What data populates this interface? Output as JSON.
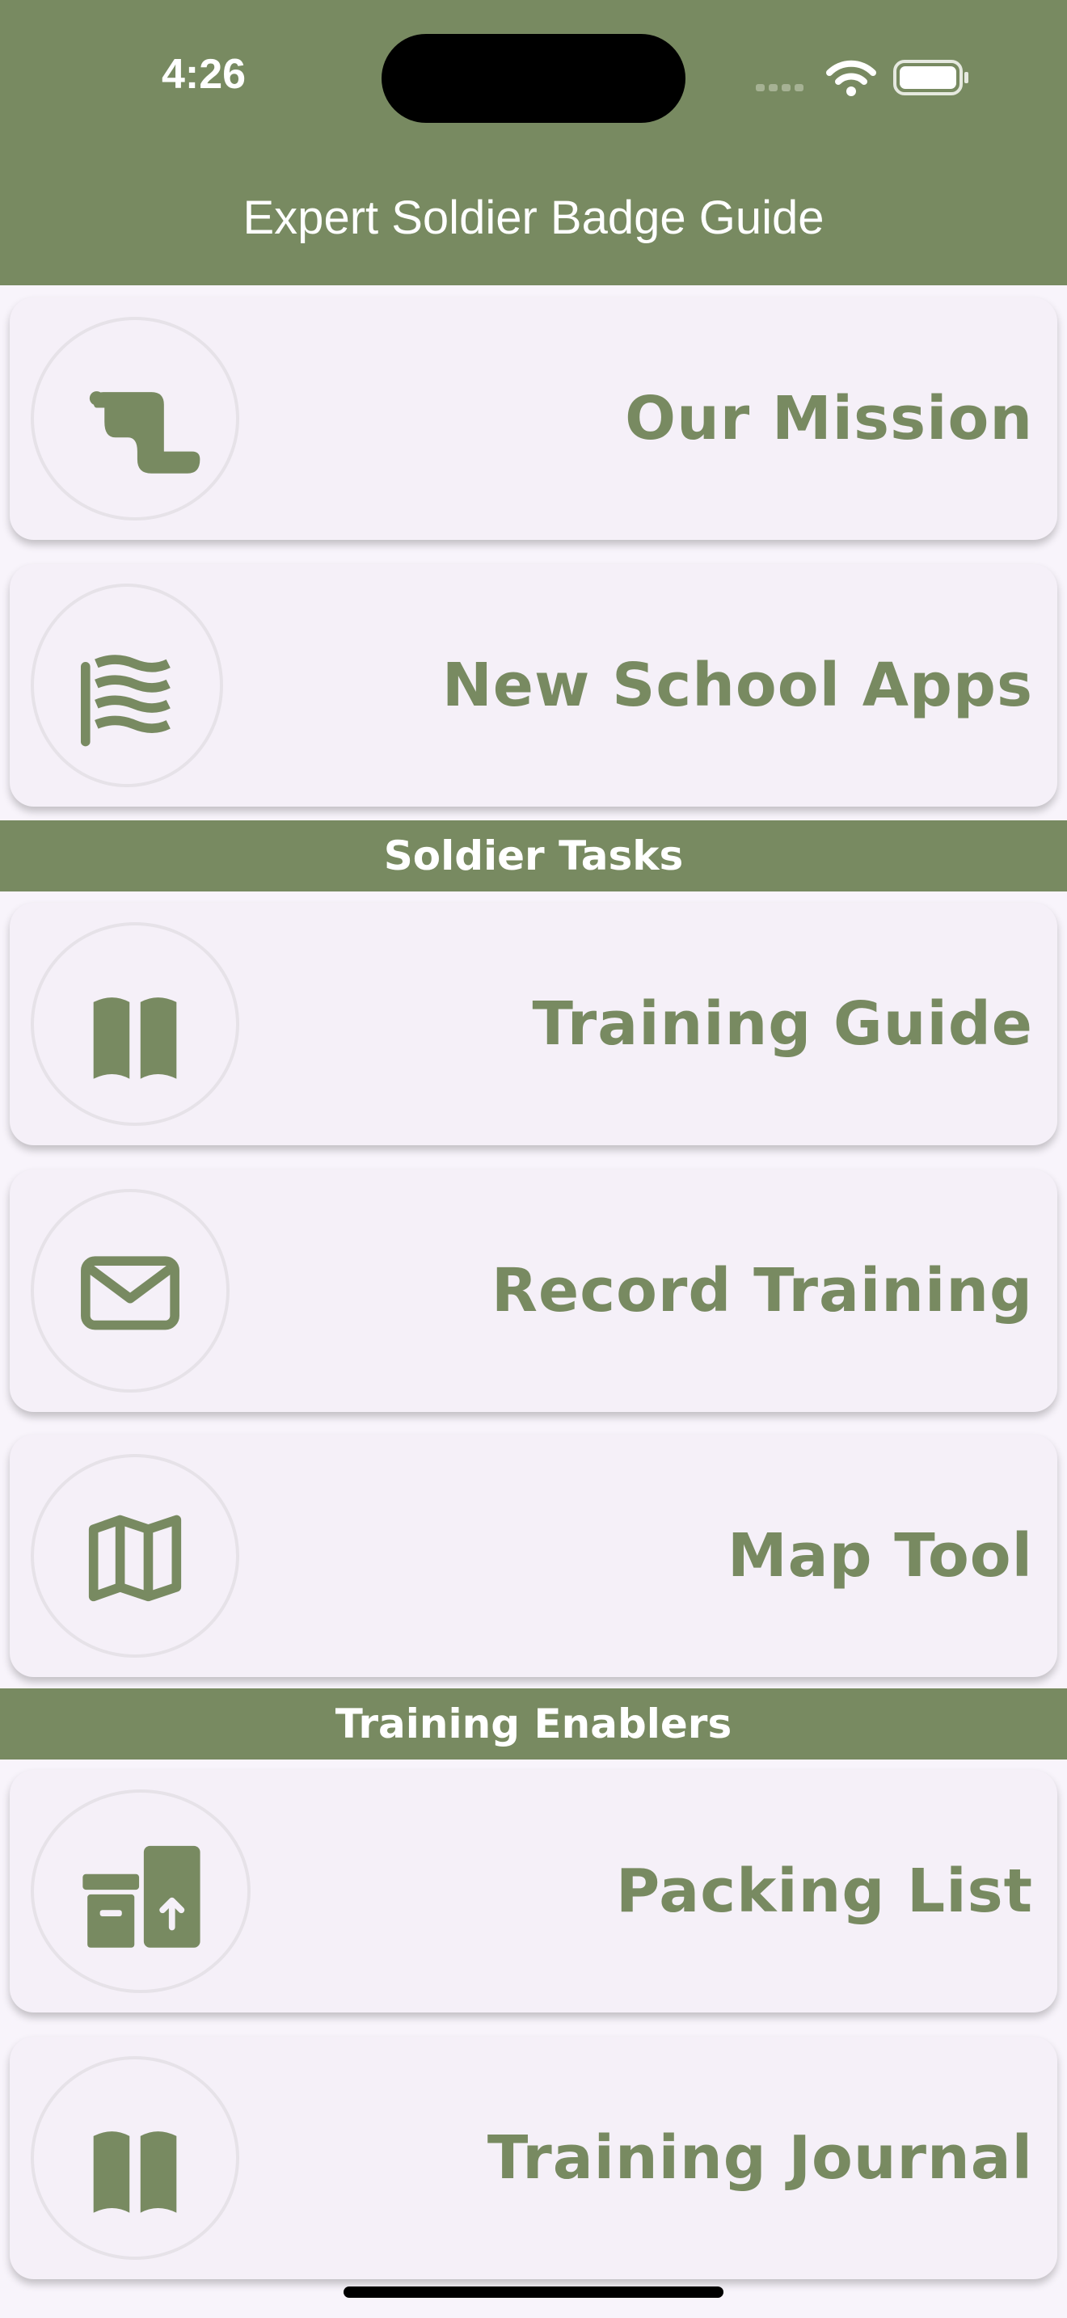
{
  "status_bar": {
    "time": "4:26"
  },
  "header": {
    "title": "Expert Soldier Badge Guide"
  },
  "menu": [
    {
      "label": "Our Mission",
      "icon": "scroll-icon"
    },
    {
      "label": "New School Apps",
      "icon": "flag-icon"
    }
  ],
  "sections": [
    {
      "title": "Soldier Tasks",
      "items": [
        {
          "label": "Training Guide",
          "icon": "book-icon"
        },
        {
          "label": "Record Training",
          "icon": "envelope-icon"
        },
        {
          "label": "Map Tool",
          "icon": "map-icon"
        }
      ]
    },
    {
      "title": "Training Enablers",
      "items": [
        {
          "label": "Packing List",
          "icon": "box-upload-icon"
        },
        {
          "label": "Training Journal",
          "icon": "book-icon"
        }
      ]
    }
  ],
  "colors": {
    "accent": "#788a61",
    "background": "#f8f4fb",
    "card": "#f5f0f8"
  }
}
